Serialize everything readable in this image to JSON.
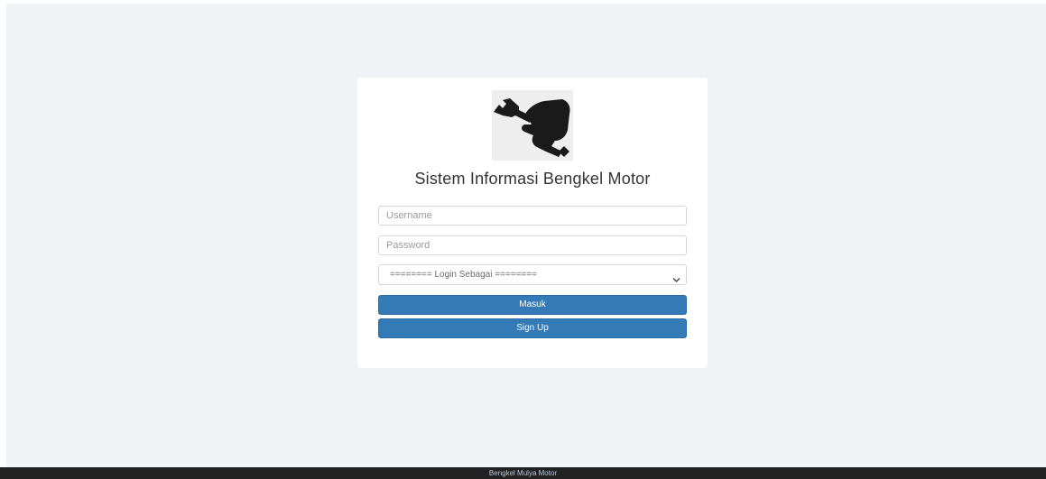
{
  "login": {
    "title": "Sistem Informasi Bengkel Motor",
    "username_placeholder": "Username",
    "password_placeholder": "Password",
    "role_select_value": "======== Login Sebagai ========",
    "login_button": "Masuk",
    "signup_button": "Sign Up"
  },
  "footer": {
    "text": "Bengkel Mulya Motor"
  },
  "colors": {
    "primary_button": "#337ab7",
    "page_background": "#f0f3f6",
    "footer_background": "#222222"
  },
  "icons": {
    "logo": "wrench-hand-icon",
    "select": "chevron-down-icon"
  }
}
